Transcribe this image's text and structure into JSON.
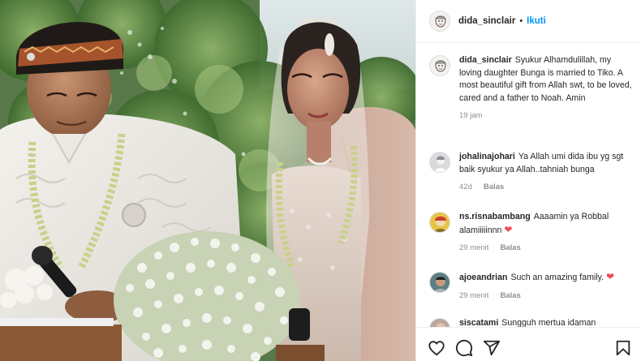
{
  "post": {
    "author": "dida_sinclair",
    "separator": "•",
    "follow_label": "Ikuti"
  },
  "comments": [
    {
      "user": "dida_sinclair",
      "text": "Syukur Alhamdulillah, my loving daughter Bunga is married to Tiko. A most beautiful gift from Allah swt, to be loved, cared and a father to Noah. Amin",
      "time": "19 jam",
      "reply": ""
    },
    {
      "user": "johalinajohari",
      "text": "Ya Allah umi dida ibu yg sgt baik syukur ya Allah..tahniah bunga",
      "time": "42d",
      "reply": "Balas"
    },
    {
      "user": "ns.risnabambang",
      "text": "Aaaamin ya Robbal alamiiiiinnn",
      "emoji": "❤",
      "time": "29 menit",
      "reply": "Balas"
    },
    {
      "user": "ajoeandrian",
      "text": "Such an amazing family.",
      "emoji": "❤",
      "time": "29 menit",
      "reply": "Balas"
    },
    {
      "user": "siscatami",
      "text": "Sungguh mertua idaman",
      "time": "",
      "reply": ""
    }
  ],
  "actions": {
    "like_icon": "heart-outline-icon",
    "comment_icon": "comment-bubble-icon",
    "share_icon": "paper-plane-icon",
    "save_icon": "bookmark-icon"
  },
  "colors": {
    "link_blue": "#0095f6",
    "meta_gray": "#8e8e8e",
    "heart_red": "#ed4956",
    "divider": "#efefef"
  }
}
